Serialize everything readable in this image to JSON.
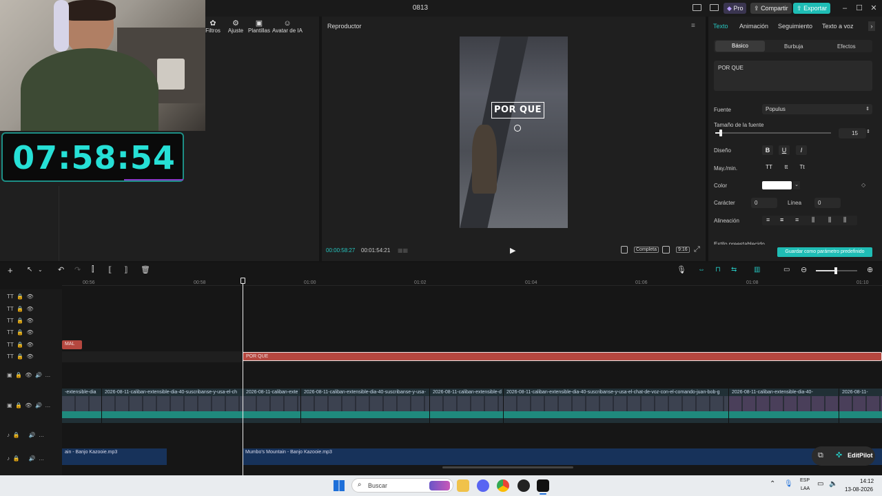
{
  "window": {
    "title": "0813",
    "pro_label": "Pro",
    "share_label": "Compartir",
    "export_label": "Exportar"
  },
  "left_toolbar": {
    "items": [
      {
        "label": "Filtros"
      },
      {
        "label": "Ajuste"
      },
      {
        "label": "Plantillas"
      },
      {
        "label": "Avatar de IA"
      }
    ]
  },
  "overlay": {
    "clock": "07:58:54"
  },
  "player": {
    "title": "Reproductor",
    "text_overlay": "POR QUE",
    "current_time": "00:00:58:27",
    "total_time": "00:01:54:21",
    "view_mode": "Completa",
    "aspect_ratio": "9:16"
  },
  "properties": {
    "tabs": [
      "Texto",
      "Animación",
      "Seguimiento",
      "Texto a voz"
    ],
    "active_tab": "Texto",
    "subtabs": [
      "Básico",
      "Burbuja",
      "Efectos"
    ],
    "active_subtab": "Básico",
    "text_value": "POR QUE",
    "font_label": "Fuente",
    "font_value": "Populus",
    "size_label": "Tamaño de la fuente",
    "size_value": "15",
    "size_fraction": 0.05,
    "style_label": "Diseño",
    "style_buttons": [
      "B",
      "U",
      "I"
    ],
    "case_label": "May./min.",
    "case_buttons": [
      "TT",
      "tt",
      "Tt"
    ],
    "color_label": "Color",
    "color_value": "#ffffff",
    "char_label": "Carácter",
    "char_value": "0",
    "line_label": "Línea",
    "line_value": "0",
    "align_label": "Alineación",
    "preset_label": "Estilo preestablecido",
    "save_preset_label": "Guardar como parámetro predefinido"
  },
  "timeline": {
    "ruler": [
      "00:56",
      "00:58",
      "01:00",
      "01:02",
      "01:04",
      "01:06",
      "01:08",
      "01:10"
    ],
    "playhead_time": "00:58",
    "text_clips": [
      {
        "label": "MAL"
      },
      {
        "label": "POR QUE"
      }
    ],
    "video_clips": [
      "-extensible-dia",
      "2026-08-11-caliban-extensible-dia-40-suscribanse-y-usa-el-ch",
      "2026-08-11-caliban-exte",
      "2026-08-11-caliban-extensible-dia-40-suscribanse-y-usa-",
      "2026-08-11-caliban-extensible-d",
      "2026-08-11-caliban-extensible-dia-40-suscribanse-y-usa-el-chat-de-voz-con-el-comando-juan-bob-g",
      "2026-08-11-caliban-extensible-dia-40-",
      "2026-08-11-"
    ],
    "audio_clips": [
      {
        "label": "ain - Banjo Kazooie.mp3"
      },
      {
        "label": "Mumbo's Mountain - Banjo Kazooie.mp3"
      }
    ],
    "editpilot_label": "EditPilot"
  },
  "taskbar": {
    "search_placeholder": "Buscar",
    "lang_top": "ESP",
    "lang_bottom": "LAA",
    "time": "14:12",
    "date": "13-08-2026"
  },
  "colors": {
    "accent": "#26c6c0",
    "text_clip": "#b5473f",
    "audio_clip": "#17325a",
    "video_wave": "#1f8a7d"
  }
}
